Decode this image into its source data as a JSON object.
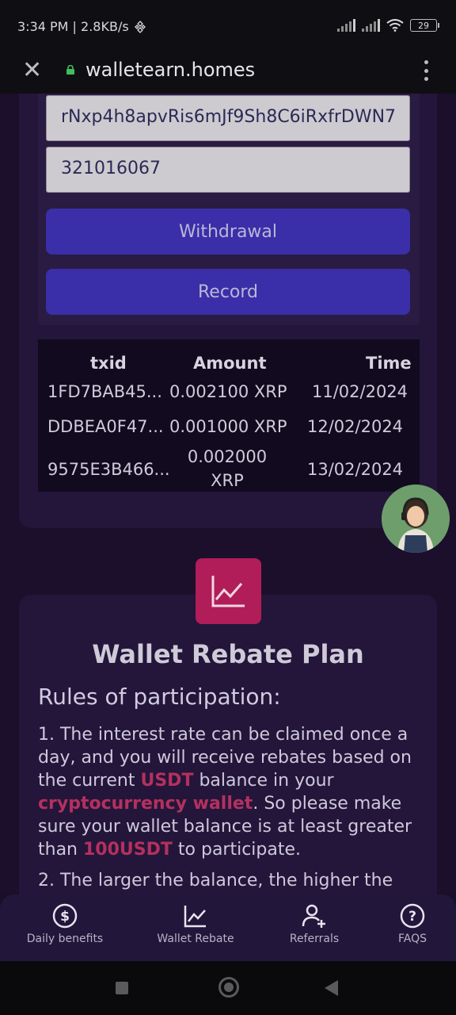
{
  "status_bar": {
    "left_text": "3:34 PM | 2.8KB/s",
    "battery": "29"
  },
  "browser": {
    "url": "walletearn.homes"
  },
  "withdraw": {
    "address_value": "rNxp4h8apvRis6mJf9Sh8C6iRxfrDWN7",
    "tag_value": "321016067",
    "withdraw_label": "Withdrawal",
    "record_label": "Record"
  },
  "records_table": {
    "headers": [
      "txid",
      "Amount",
      "Time"
    ],
    "rows": [
      {
        "txid": "1FD7BAB45...",
        "amount": "0.002100 XRP",
        "time": "11/02/2024"
      },
      {
        "txid": "DDBEA0F47...",
        "amount": "0.001000 XRP",
        "time": "12/02/2024"
      },
      {
        "txid": "9575E3B466...",
        "amount_line1": "0.002000",
        "amount_line2": "XRP",
        "time": "13/02/2024"
      }
    ]
  },
  "rebate": {
    "title": "Wallet Rebate Plan",
    "rules_title": "Rules of participation:",
    "rule1_a": "1. The interest rate can be claimed once a day, and you will receive rebates based on the current ",
    "rule1_hl1": "USDT",
    "rule1_b": " balance in your ",
    "rule1_hl2": "cryptocurrency wallet",
    "rule1_c": ". So please make sure your wallet balance is at least greater than ",
    "rule1_hl3": "100USDT",
    "rule1_d": " to participate.",
    "rule2": "2. The larger the balance, the higher the",
    "accent_color": "#b11d58"
  },
  "tabbar": {
    "items": [
      {
        "label": "Daily benefits",
        "icon": "dollar-circle-icon"
      },
      {
        "label": "Wallet Rebate",
        "icon": "chart-line-icon"
      },
      {
        "label": "Referrals",
        "icon": "add-user-icon"
      },
      {
        "label": "FAQS",
        "icon": "question-circle-icon"
      }
    ]
  }
}
